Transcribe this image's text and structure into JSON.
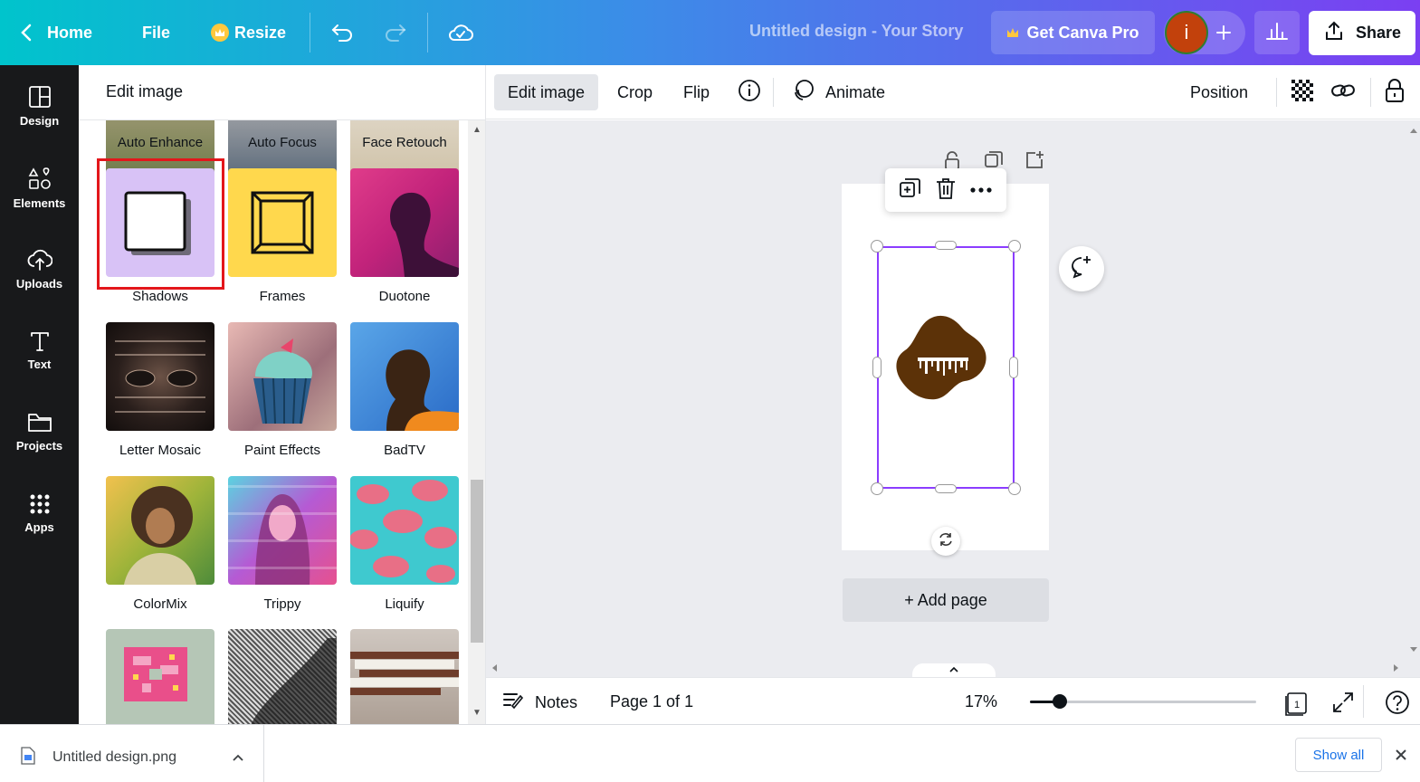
{
  "topbar": {
    "home_label": "Home",
    "file_label": "File",
    "resize_label": "Resize",
    "doc_title": "Untitled design - Your Story",
    "pro_label": "Get Canva Pro",
    "avatar_initial": "i",
    "share_label": "Share"
  },
  "rail": {
    "items": [
      {
        "label": "Design",
        "icon": "layout-icon"
      },
      {
        "label": "Elements",
        "icon": "shapes-icon"
      },
      {
        "label": "Uploads",
        "icon": "cloud-upload-icon"
      },
      {
        "label": "Text",
        "icon": "text-icon"
      },
      {
        "label": "Projects",
        "icon": "folder-icon"
      },
      {
        "label": "Apps",
        "icon": "grid-icon"
      }
    ]
  },
  "panel": {
    "title": "Edit image",
    "effects": [
      {
        "label": "Auto Enhance"
      },
      {
        "label": "Auto Focus"
      },
      {
        "label": "Face Retouch"
      },
      {
        "label": "Shadows"
      },
      {
        "label": "Frames"
      },
      {
        "label": "Duotone"
      },
      {
        "label": "Letter Mosaic"
      },
      {
        "label": "Paint Effects"
      },
      {
        "label": "BadTV"
      },
      {
        "label": "ColorMix"
      },
      {
        "label": "Trippy"
      },
      {
        "label": "Liquify"
      }
    ]
  },
  "context_toolbar": {
    "edit_image_label": "Edit image",
    "crop_label": "Crop",
    "flip_label": "Flip",
    "animate_label": "Animate",
    "position_label": "Position"
  },
  "canvas": {
    "add_page_label": "+ Add page"
  },
  "bottombar": {
    "notes_label": "Notes",
    "page_indicator": "Page 1 of 1",
    "zoom_label": "17%",
    "zoom_fraction": 0.13,
    "page_count": "1"
  },
  "downloads": {
    "file_name": "Untitled design.png",
    "show_all_label": "Show all"
  },
  "colors": {
    "accent": "#8b3dff",
    "brand_gradient_start": "#00c4cc",
    "brand_gradient_end": "#7b3ff2",
    "highlight": "#e3161b",
    "blob": "#5c3208"
  }
}
